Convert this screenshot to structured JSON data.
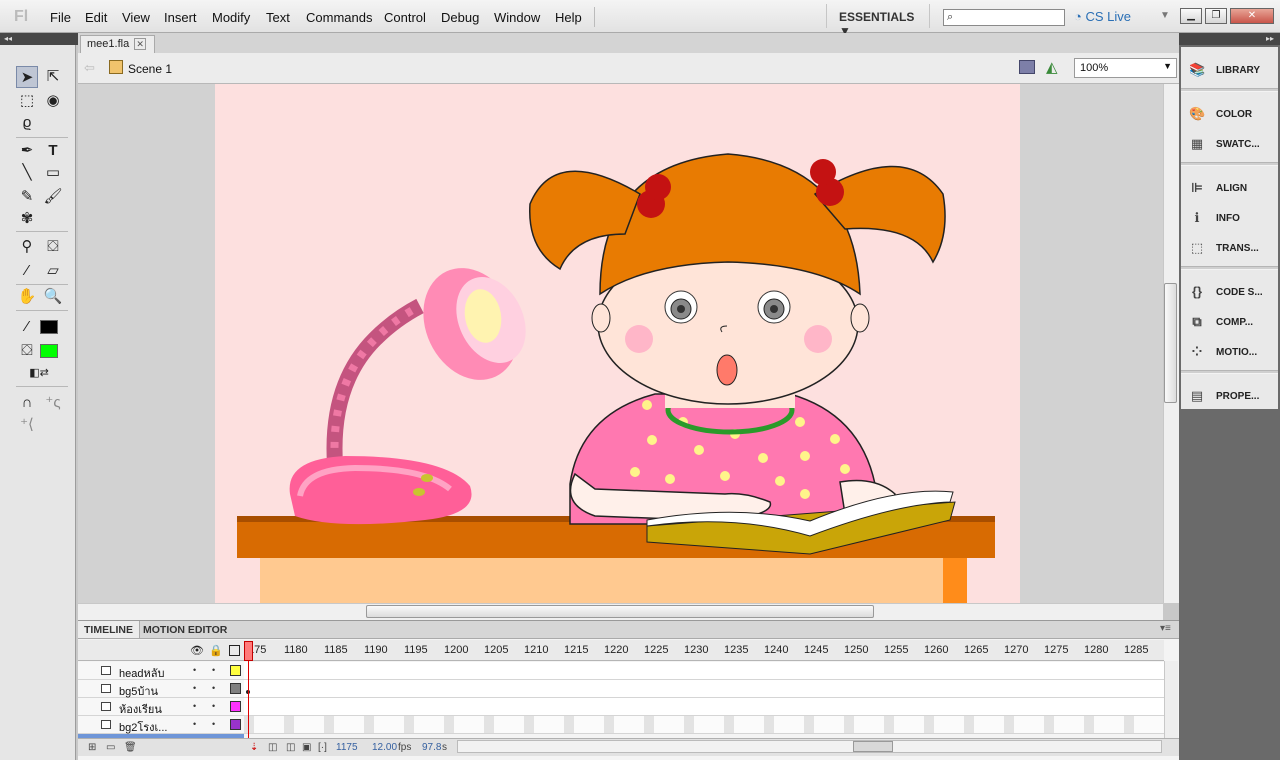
{
  "app": {
    "logo": "Fl"
  },
  "menu": [
    "File",
    "Edit",
    "View",
    "Insert",
    "Modify",
    "Text",
    "Commands",
    "Control",
    "Debug",
    "Window",
    "Help"
  ],
  "workspace": "ESSENTIALS ▼",
  "cslive": "CS Live",
  "document": {
    "tab": "mee1.fla",
    "scene": "Scene 1",
    "zoom": "100%"
  },
  "timeline": {
    "tabs": [
      "TIMELINE",
      "MOTION EDITOR"
    ],
    "ruler": [
      "175",
      "1180",
      "1185",
      "1190",
      "1195",
      "1200",
      "1205",
      "1210",
      "1215",
      "1220",
      "1225",
      "1230",
      "1235",
      "1240",
      "1245",
      "1250",
      "1255",
      "1260",
      "1265",
      "1270",
      "1275",
      "1280",
      "1285"
    ],
    "layers": [
      {
        "name": "headหลับ",
        "color": "#ffff40"
      },
      {
        "name": "bg5บ้าน",
        "color": "#808080"
      },
      {
        "name": "ห้องเรียน",
        "color": "#ff33ff"
      },
      {
        "name": "bg2โรงเ...",
        "color": "#9933cc"
      }
    ],
    "footer": {
      "frame": "1175",
      "fps_value": "12.00",
      "fps_unit": "fps",
      "time_value": "97.8",
      "time_unit": "s"
    }
  },
  "panels": [
    "LIBRARY",
    "COLOR",
    "SWATC...",
    "ALIGN",
    "INFO",
    "TRANS...",
    "CODE S...",
    "COMP...",
    "MOTIO...",
    "PROPE..."
  ],
  "colors": {
    "stroke": "#000000",
    "fill": "#00ff00",
    "stage": "#fde0df"
  }
}
